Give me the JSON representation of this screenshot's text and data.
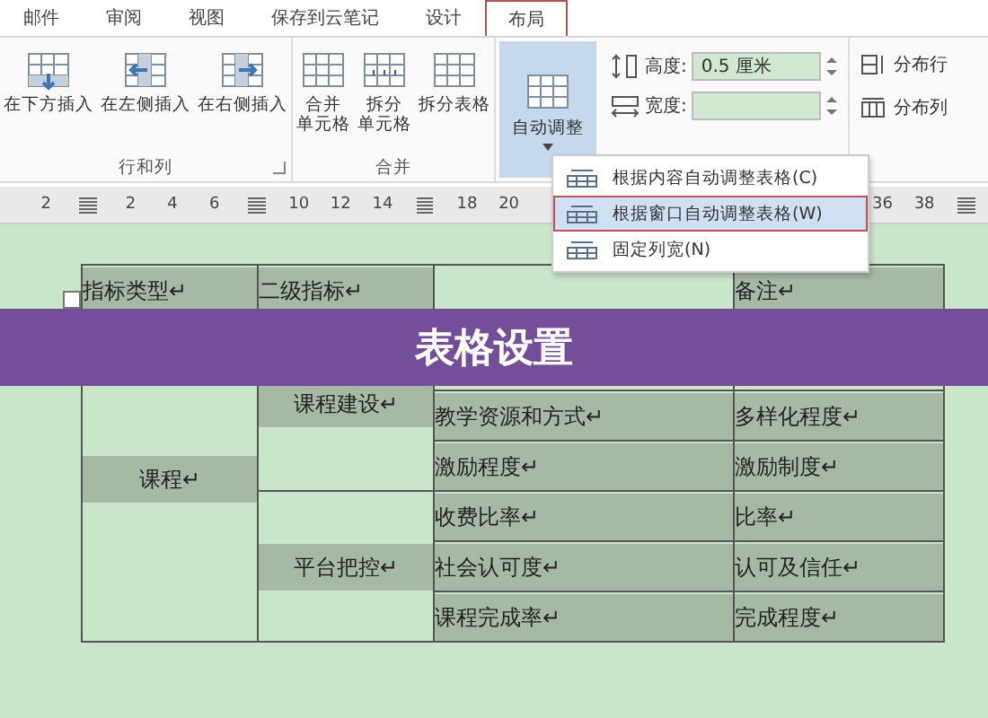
{
  "tabs": [
    {
      "label": "邮件",
      "selected": false
    },
    {
      "label": "审阅",
      "selected": false
    },
    {
      "label": "视图",
      "selected": false
    },
    {
      "label": "保存到云笔记",
      "selected": false
    },
    {
      "label": "设计",
      "selected": false
    },
    {
      "label": "布局",
      "selected": true
    }
  ],
  "ribbon": {
    "groups": [
      {
        "label": "行和列",
        "launcher": true,
        "buttons": [
          {
            "label": "在下方插入",
            "kind": "below"
          },
          {
            "label": "在左侧插入",
            "kind": "left"
          },
          {
            "label": "在右侧插入",
            "kind": "right"
          }
        ]
      },
      {
        "label": "合并",
        "buttons": [
          {
            "lines": [
              "合并",
              "单元格"
            ],
            "kind": "merge"
          },
          {
            "lines": [
              "拆分",
              "单元格"
            ],
            "kind": "split"
          },
          {
            "label": "拆分表格",
            "kind": "splittable"
          }
        ]
      }
    ],
    "autofit": {
      "label": "自动调整",
      "selected": true
    },
    "height": {
      "label": "高度:",
      "value": "0.5 厘米"
    },
    "width": {
      "label": "宽度:"
    },
    "distribute": [
      {
        "label": "分布行",
        "kind": "rows"
      },
      {
        "label": "分布列",
        "kind": "cols"
      }
    ]
  },
  "ruler": [
    {
      "kind": "num",
      "text": "2"
    },
    {
      "kind": "marker"
    },
    {
      "kind": "num",
      "text": "2"
    },
    {
      "kind": "num",
      "text": "4"
    },
    {
      "kind": "num",
      "text": "6"
    },
    {
      "kind": "marker"
    },
    {
      "kind": "num",
      "text": "10"
    },
    {
      "kind": "num",
      "text": "12"
    },
    {
      "kind": "num",
      "text": "14"
    },
    {
      "kind": "marker"
    },
    {
      "kind": "num",
      "text": "18"
    },
    {
      "kind": "num",
      "text": "20"
    },
    {
      "kind": "gap"
    },
    {
      "kind": "num",
      "text": "36"
    },
    {
      "kind": "num",
      "text": "38"
    },
    {
      "kind": "marker"
    }
  ],
  "menu": [
    {
      "label": "根据内容自动调整表格(C)",
      "selected": false
    },
    {
      "label": "根据窗口自动调整表格(W)",
      "selected": true
    },
    {
      "label": "固定列宽(N)",
      "selected": false
    }
  ],
  "table": {
    "columns": [
      "指标类型↵",
      "二级指标↵",
      "",
      "备注↵"
    ],
    "category": "课程↵",
    "groups": [
      {
        "name": "课程建设↵",
        "rows": [
          {
            "covered": true
          },
          {
            "cells": [
              "教学资源和方式↵",
              "多样化程度↵"
            ]
          },
          {
            "cells": [
              "激励程度↵",
              "激励制度↵"
            ]
          }
        ]
      },
      {
        "name": "平台把控↵",
        "rows": [
          {
            "cells": [
              "收费比率↵",
              "比率↵"
            ]
          },
          {
            "cells": [
              "社会认可度↵",
              "认可及信任↵"
            ]
          },
          {
            "cells": [
              "课程完成率↵",
              "完成程度↵"
            ]
          }
        ]
      }
    ]
  },
  "banner": {
    "title": "表格设置"
  }
}
